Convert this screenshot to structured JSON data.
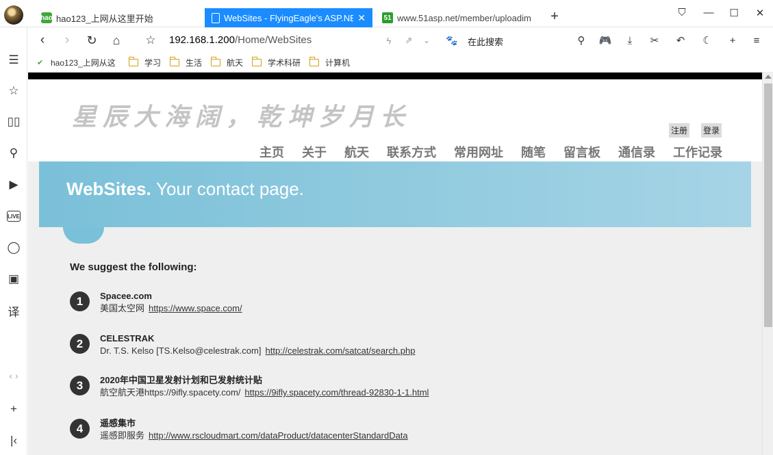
{
  "tabs": [
    {
      "title": "hao123_上网从这里开始"
    },
    {
      "title": "WebSites - FlyingEagle's ASP.NET"
    },
    {
      "title": "www.51asp.net/member/uploadim"
    }
  ],
  "toolbar": {
    "url_host": "192.168.1.200",
    "url_path": "/Home/WebSites",
    "search_placeholder": "在此搜索"
  },
  "bookmarks": [
    "hao123_上网从这",
    "学习",
    "生活",
    "航天",
    "学术科研",
    "计算机"
  ],
  "page": {
    "slogan": "星辰大海阔，乾坤岁月长",
    "register": "注册",
    "login": "登录",
    "menu": [
      "主页",
      "关于",
      "航天",
      "联系方式",
      "常用网址",
      "随笔",
      "留言板",
      "通信录",
      "工作记录"
    ],
    "hero_title": "WebSites.",
    "hero_sub": "Your contact page.",
    "suggest": "We suggest the following:",
    "items": [
      {
        "num": "1",
        "title": "Spacee.com",
        "desc": "美国太空网",
        "link": "https://www.space.com/"
      },
      {
        "num": "2",
        "title": "CELESTRAK",
        "desc": "Dr. T.S. Kelso [TS.Kelso@celestrak.com]",
        "link": "http://celestrak.com/satcat/search.php"
      },
      {
        "num": "3",
        "title": "2020年中国卫星发射计划和已发射统计贴",
        "desc": "航空航天港https://9ifly.spacety.com/",
        "link": "https://9ifly.spacety.com/thread-92830-1-1.html"
      },
      {
        "num": "4",
        "title": "遥感集市",
        "desc": "遥感即服务",
        "link": "http://www.rscloudmart.com/dataProduct/datacenterStandardData"
      }
    ]
  }
}
